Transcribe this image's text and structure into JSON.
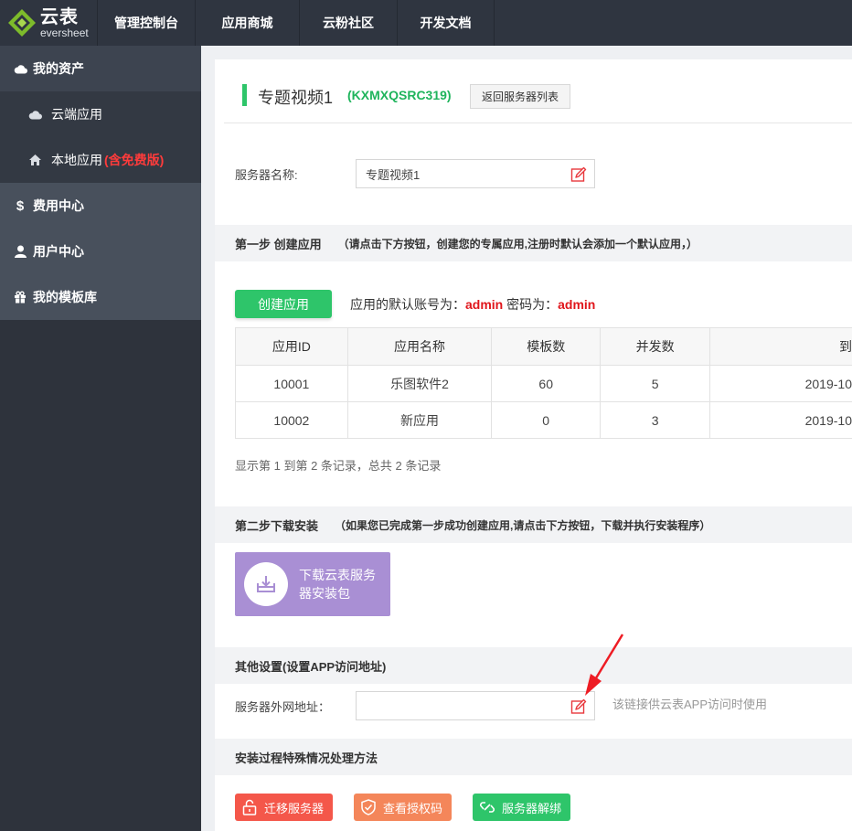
{
  "brand": {
    "name_cn": "云表",
    "name_en": "eversheet"
  },
  "topnav": {
    "items": [
      "管理控制台",
      "应用商城",
      "云粉社区",
      "开发文档"
    ]
  },
  "sidebar": {
    "my_assets": "我的资产",
    "cloud_apps": "云端应用",
    "local_apps": "本地应用",
    "local_apps_note": "(含免费版)",
    "billing": "费用中心",
    "user_center": "用户中心",
    "templates": "我的模板库"
  },
  "header": {
    "title": "专题视频1",
    "code": "(KXMXQSRC319)",
    "back_label": "返回服务器列表"
  },
  "server_name": {
    "label": "服务器名称:",
    "value": "专题视频1"
  },
  "step1": {
    "title": "第一步 创建应用",
    "note": "（请点击下方按钮，创建您的专属应用,注册时默认会添加一个默认应用，）",
    "create_label": "创建应用",
    "acct_prefix": "应用的默认账号为：",
    "acct_user": "admin",
    "acct_mid": " 密码为：",
    "acct_pass": "admin"
  },
  "table": {
    "headers": [
      "应用ID",
      "应用名称",
      "模板数",
      "并发数",
      "到"
    ],
    "rows": [
      [
        "10001",
        "乐图软件2",
        "60",
        "5",
        "2019-10"
      ],
      [
        "10002",
        "新应用",
        "0",
        "3",
        "2019-10"
      ]
    ],
    "record_note": "显示第 1 到第 2 条记录，总共 2 条记录"
  },
  "step2": {
    "title": "第二步下载安装",
    "note": "（如果您已完成第一步成功创建应用,请点击下方按钮，下载并执行安装程序）",
    "download_line1": "下载云表服务",
    "download_line2": "器安装包"
  },
  "other": {
    "title": "其他设置(设置APP访问地址)",
    "label": "服务器外网地址：",
    "value": "",
    "help": "该链接供云表APP访问时使用"
  },
  "special": {
    "title": "安装过程特殊情况处理方法",
    "migrate": "迁移服务器",
    "license": "查看授权码",
    "unbind": "服务器解绑"
  },
  "colors": {
    "green": "#2ec56a",
    "red": "#ff3b3b",
    "purple": "#a98fd4",
    "coral": "#f4574a",
    "orange": "#f4865a"
  }
}
